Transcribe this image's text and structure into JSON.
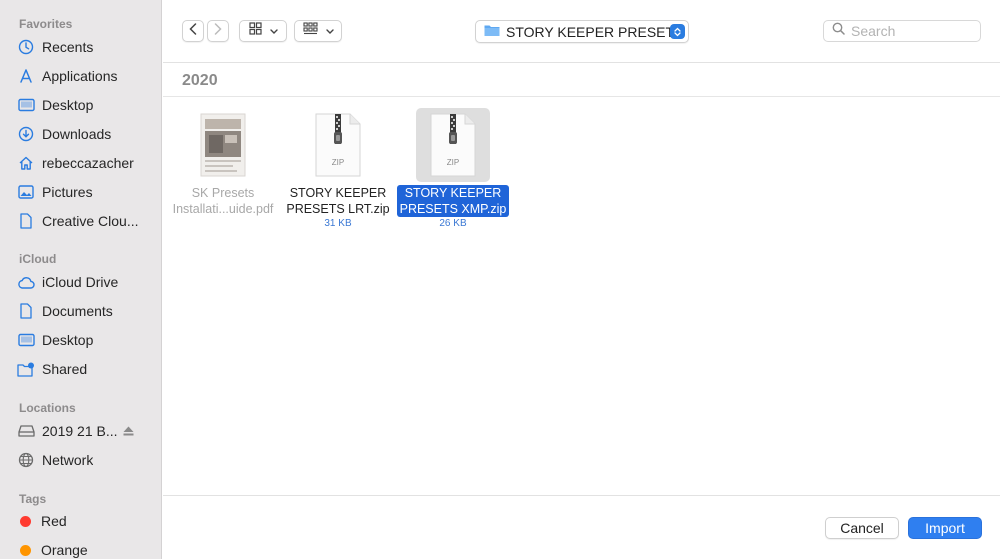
{
  "sidebar": {
    "favorites_title": "Favorites",
    "favorites": [
      {
        "label": "Recents",
        "icon": "clock-icon"
      },
      {
        "label": "Applications",
        "icon": "applications-icon"
      },
      {
        "label": "Desktop",
        "icon": "desktop-icon"
      },
      {
        "label": "Downloads",
        "icon": "download-icon"
      },
      {
        "label": "rebeccazacher",
        "icon": "home-icon"
      },
      {
        "label": "Pictures",
        "icon": "pictures-icon"
      },
      {
        "label": "Creative Clou...",
        "icon": "document-icon"
      }
    ],
    "icloud_title": "iCloud",
    "icloud": [
      {
        "label": "iCloud Drive",
        "icon": "cloud-icon"
      },
      {
        "label": "Documents",
        "icon": "document-icon"
      },
      {
        "label": "Desktop",
        "icon": "desktop-icon"
      },
      {
        "label": "Shared",
        "icon": "shared-folder-icon"
      }
    ],
    "locations_title": "Locations",
    "locations": [
      {
        "label": "2019 21 B...",
        "icon": "drive-icon"
      },
      {
        "label": "Network",
        "icon": "network-icon"
      }
    ],
    "tags_title": "Tags",
    "tags": [
      {
        "label": "Red",
        "color": "#ff3b30"
      },
      {
        "label": "Orange",
        "color": "#ff9500"
      }
    ]
  },
  "toolbar": {
    "path_label": "STORY KEEPER PRESETS",
    "search_placeholder": "Search"
  },
  "content": {
    "group_title": "2020",
    "files": [
      {
        "name_line1": "SK Presets",
        "name_line2": "Installati...uide.pdf",
        "size": "",
        "kind": "pdf",
        "dimmed": true,
        "selected": false
      },
      {
        "name_line1": "STORY KEEPER",
        "name_line2": "PRESETS LRT.zip",
        "size": "31 KB",
        "kind": "zip",
        "dimmed": false,
        "selected": false,
        "badge": "ZIP"
      },
      {
        "name_line1": "STORY KEEPER",
        "name_line2": "PRESETS XMP.zip",
        "size": "26 KB",
        "kind": "zip",
        "dimmed": false,
        "selected": true,
        "badge": "ZIP"
      }
    ]
  },
  "footer": {
    "cancel_label": "Cancel",
    "import_label": "Import"
  },
  "colors": {
    "accent": "#2f7ff0",
    "selection": "#1f64d8",
    "sidebar_bg": "#e9e7e8"
  }
}
